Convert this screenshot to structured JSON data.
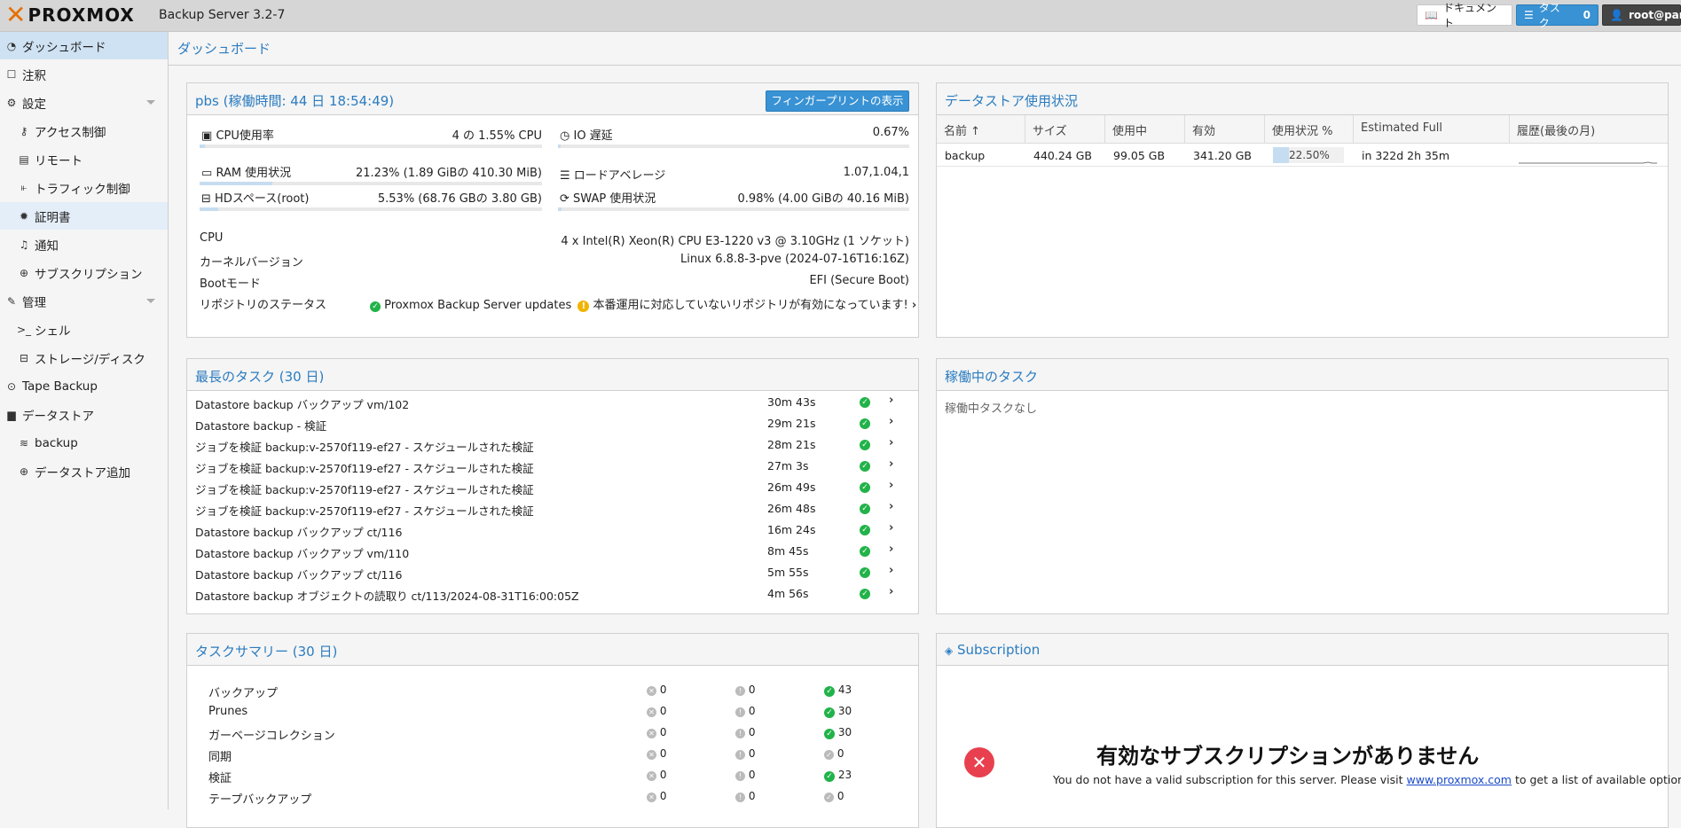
{
  "topbar": {
    "logo_text": "PROXMOX",
    "version": "Backup Server 3.2-7",
    "docs_label": "ドキュメント",
    "tasks_label": "タスク",
    "tasks_count": "0",
    "user_label": "root@pam"
  },
  "sidebar": {
    "items": [
      {
        "label": "ダッシュボード",
        "icon": "dashboard-icon"
      },
      {
        "label": "注釈",
        "icon": "note-icon"
      },
      {
        "label": "設定",
        "icon": "gears-icon"
      },
      {
        "label": "アクセス制御",
        "icon": "key-icon"
      },
      {
        "label": "リモート",
        "icon": "server-icon"
      },
      {
        "label": "トラフィック制御",
        "icon": "bar-chart-icon"
      },
      {
        "label": "証明書",
        "icon": "certificate-icon"
      },
      {
        "label": "通知",
        "icon": "bell-icon"
      },
      {
        "label": "サブスクリプション",
        "icon": "support-icon"
      },
      {
        "label": "管理",
        "icon": "wrench-icon"
      },
      {
        "label": "シェル",
        "icon": "terminal-icon"
      },
      {
        "label": "ストレージ/ディスク",
        "icon": "hdd-icon"
      },
      {
        "label": "Tape Backup",
        "icon": "tape-icon"
      },
      {
        "label": "データストア",
        "icon": "archive-icon"
      },
      {
        "label": "backup",
        "icon": "database-icon"
      },
      {
        "label": "データストア追加",
        "icon": "plus-circle-icon"
      }
    ]
  },
  "page": {
    "title": "ダッシュボード"
  },
  "status": {
    "title": "pbs (稼働時間: 44 日 18:54:49)",
    "fingerprint_button": "フィンガープリントの表示",
    "cpu": {
      "label": "CPU使用率",
      "value": "4 の 1.55% CPU",
      "fraction": 0.0155
    },
    "io": {
      "label": "IO 遅延",
      "value": "0.67%",
      "fraction": 0.0067
    },
    "ram": {
      "label": "RAM 使用状況",
      "value": "21.23% (1.89 GiBの 410.30 MiB)",
      "fraction": 0.2123
    },
    "load": {
      "label": "ロードアベレージ",
      "value": "1.07,1.04,1"
    },
    "hd": {
      "label": "HDスペース(root)",
      "value": "5.53% (68.76 GBの 3.80 GB)",
      "fraction": 0.0553
    },
    "swap": {
      "label": "SWAP 使用状況",
      "value": "0.98% (4.00 GiBの 40.16 MiB)",
      "fraction": 0.0098
    },
    "info": [
      {
        "label": "CPU",
        "value": "4 x Intel(R) Xeon(R) CPU E3-1220 v3 @ 3.10GHz (1 ソケット)"
      },
      {
        "label": "カーネルバージョン",
        "value": "Linux 6.8.8-3-pve (2024-07-16T16:16Z)"
      },
      {
        "label": "Bootモード",
        "value": "EFI (Secure Boot)"
      }
    ],
    "repo_label": "リポジトリのステータス",
    "repo_ok": "Proxmox Backup Server updates",
    "repo_warn": "本番運用に対応していないリポジトリが有効になっています!"
  },
  "datastore_usage": {
    "title": "データストア使用状況",
    "columns": [
      "名前 ↑",
      "サイズ",
      "使用中",
      "有効",
      "使用状況 %",
      "Estimated Full",
      "履歴(最後の月)"
    ],
    "rows": [
      {
        "name": "backup",
        "size": "440.24 GB",
        "used": "99.05 GB",
        "avail": "341.20 GB",
        "usage": "22.50%",
        "usage_fraction": 0.225,
        "estimated_full": "in 322d 2h 35m"
      }
    ]
  },
  "longest_tasks": {
    "title": "最長のタスク (30 日)",
    "rows": [
      {
        "name": "Datastore backup バックアップ vm/102",
        "duration": "30m 43s"
      },
      {
        "name": "Datastore backup - 検証",
        "duration": "29m 21s"
      },
      {
        "name": "ジョブを検証 backup:v-2570f119-ef27 - スケジュールされた検証",
        "duration": "28m 21s"
      },
      {
        "name": "ジョブを検証 backup:v-2570f119-ef27 - スケジュールされた検証",
        "duration": "27m 3s"
      },
      {
        "name": "ジョブを検証 backup:v-2570f119-ef27 - スケジュールされた検証",
        "duration": "26m 49s"
      },
      {
        "name": "ジョブを検証 backup:v-2570f119-ef27 - スケジュールされた検証",
        "duration": "26m 48s"
      },
      {
        "name": "Datastore backup バックアップ ct/116",
        "duration": "16m 24s"
      },
      {
        "name": "Datastore backup バックアップ vm/110",
        "duration": "8m 45s"
      },
      {
        "name": "Datastore backup バックアップ ct/116",
        "duration": "5m 55s"
      },
      {
        "name": "Datastore backup オブジェクトの読取り ct/113/2024-08-31T16:00:05Z",
        "duration": "4m 56s"
      }
    ]
  },
  "running_tasks": {
    "title": "稼働中のタスク",
    "empty": "稼働中タスクなし"
  },
  "task_summary": {
    "title": "タスクサマリー (30 日)",
    "rows": [
      {
        "label": "バックアップ",
        "error": "0",
        "warning": "0",
        "ok": "43",
        "ok_green": true
      },
      {
        "label": "Prunes",
        "error": "0",
        "warning": "0",
        "ok": "30",
        "ok_green": true
      },
      {
        "label": "ガーベージコレクション",
        "error": "0",
        "warning": "0",
        "ok": "30",
        "ok_green": true
      },
      {
        "label": "同期",
        "error": "0",
        "warning": "0",
        "ok": "0",
        "ok_green": false
      },
      {
        "label": "検証",
        "error": "0",
        "warning": "0",
        "ok": "23",
        "ok_green": true
      },
      {
        "label": "テープバックアップ",
        "error": "0",
        "warning": "0",
        "ok": "0",
        "ok_green": false
      }
    ]
  },
  "subscription": {
    "title": "Subscription",
    "heading": "有効なサブスクリプションがありません",
    "text_before": "You do not have a valid subscription for this server. Please visit",
    "link": "www.proxmox.com",
    "text_after": "to get a list of available options."
  }
}
